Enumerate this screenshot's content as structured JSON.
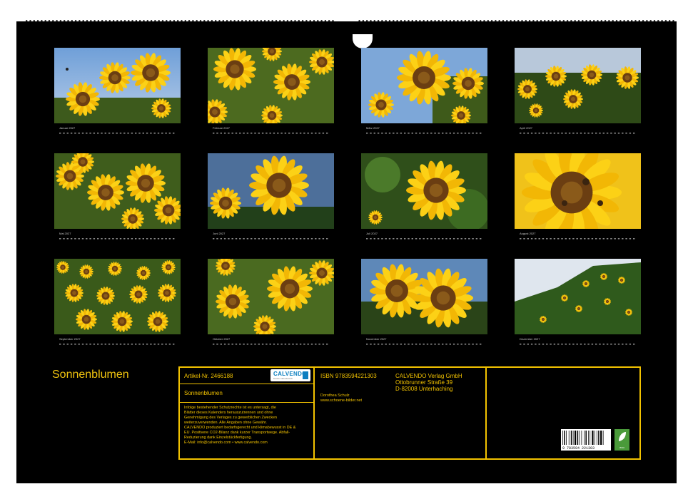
{
  "cover": {
    "title": "Sonnenblumen",
    "colors": {
      "accent": "#f2c200",
      "background": "#000000"
    }
  },
  "months": [
    {
      "label": "Januar 2027",
      "photo": "sunflowers-with-bee-blue-sky"
    },
    {
      "label": "Februar 2027",
      "photo": "sunflower-field-close"
    },
    {
      "label": "März 2027",
      "photo": "sunflower-against-blue-sky"
    },
    {
      "label": "April 2027",
      "photo": "sunflower-row-cloudy-sky"
    },
    {
      "label": "Mai 2027",
      "photo": "sunflower-cluster"
    },
    {
      "label": "Juni 2027",
      "photo": "sunflower-side-view"
    },
    {
      "label": "Juli 2027",
      "photo": "single-sunflower-green-leaves"
    },
    {
      "label": "August 2027",
      "photo": "sunflower-macro-with-bees"
    },
    {
      "label": "September 2027",
      "photo": "sunflower-field-wide"
    },
    {
      "label": "Oktober 2027",
      "photo": "sunflowers-mixed-field"
    },
    {
      "label": "November 2027",
      "photo": "two-sunflowers-close"
    },
    {
      "label": "Dezember 2027",
      "photo": "sunflower-hill-cloudy-sky"
    }
  ],
  "info": {
    "article_no": "Artikel-Nr. 2466188",
    "logo_text": "CALVENDO",
    "logo_sub": "kreativ. kalendarisch.",
    "product_title": "Sonnenblumen",
    "legal": [
      "Infolge bestehender Schutzrechte ist es untersagt, die",
      "Blätter dieses Kalenders herauszutrennen und ohne",
      "Genehmigung des Verlages zu gewerblichen Zwecken",
      "weiterzuverwenden. Alle Angaben ohne Gewähr.",
      "CALVENDO produziert bedarfsgerecht und klimabewusst in DE &",
      "EU. Positivere CO2-Bilanz dank kurzer Transportwege. Abfall-",
      "Reduzierung dank Einzelstückfertigung.",
      "E-Mail: info@calvendo.com • www.calvendo.com"
    ],
    "isbn": "ISBN 9783594221303",
    "author": "Dorothea Schulz",
    "website": "www.schoene-bilder.net",
    "publisher": [
      "CALVENDO Verlag GmbH",
      "Ottobrunner Straße 39",
      "D-82008 Unterhaching"
    ],
    "barcode_number": "9 783594 221303",
    "eco_label": "eco"
  }
}
